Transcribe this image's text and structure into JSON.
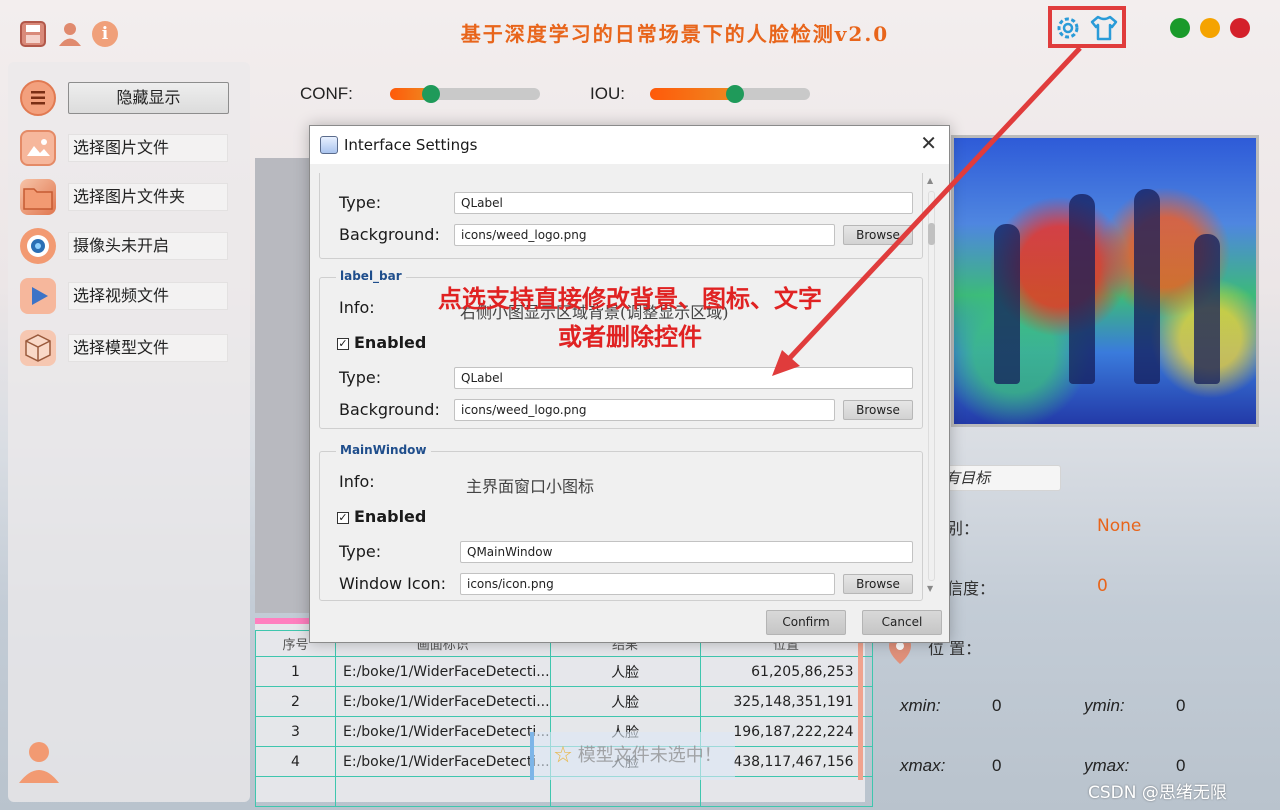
{
  "app": {
    "title": "基于深度学习的日常场景下的人脸检测v2.0"
  },
  "top_icons": [
    "save-icon",
    "user-icon",
    "info-icon"
  ],
  "header_tools": [
    "settings-gear-icon",
    "theme-shirt-icon"
  ],
  "window_controls": {
    "colors": [
      "#1a9a2a",
      "#f5a300",
      "#d4202a"
    ]
  },
  "sidebar": {
    "toggle_label": "隐藏显示",
    "items": [
      {
        "label": "选择图片文件",
        "icon": "image-file-icon"
      },
      {
        "label": "选择图片文件夹",
        "icon": "folder-icon"
      },
      {
        "label": "摄像头未开启",
        "icon": "camera-icon"
      },
      {
        "label": "选择视频文件",
        "icon": "video-play-icon"
      },
      {
        "label": "选择模型文件",
        "icon": "model-box-icon"
      }
    ]
  },
  "sliders": {
    "conf_label": "CONF:",
    "conf_value": 0.27,
    "iou_label": "IOU:",
    "iou_value": 0.53
  },
  "info_panel": {
    "target_placeholder": "有目标",
    "class_label": "别：",
    "class_value": "None",
    "conf_label": "信度：",
    "conf_value": "0",
    "pos_label": "位 置：",
    "xmin_label": "xmin:",
    "xmin_value": "0",
    "ymin_label": "ymin:",
    "ymin_value": "0",
    "xmax_label": "xmax:",
    "xmax_value": "0",
    "ymax_label": "ymax:",
    "ymax_value": "0"
  },
  "table": {
    "headers": [
      "序号",
      "画面标识",
      "结果",
      "位置"
    ],
    "rows": [
      [
        "1",
        "E:/boke/1/WiderFaceDetecti...",
        "人脸",
        "61,205,86,253"
      ],
      [
        "2",
        "E:/boke/1/WiderFaceDetecti...",
        "人脸",
        "325,148,351,191"
      ],
      [
        "3",
        "E:/boke/1/WiderFaceDetecti...",
        "人脸",
        "196,187,222,224"
      ],
      [
        "4",
        "E:/boke/1/WiderFaceDetecti...",
        "人脸",
        "438,117,467,156"
      ]
    ]
  },
  "toast": {
    "text": "模型文件未选中！"
  },
  "dialog": {
    "title": "Interface Settings",
    "close": "✕",
    "group0": {
      "type_label": "Type:",
      "type_value": "QLabel",
      "bg_label": "Background:",
      "bg_value": "icons/weed_logo.png",
      "browse": "Browse"
    },
    "group1": {
      "title": "label_bar",
      "info_label": "Info:",
      "info_value": "右侧小图显示区域背景(调整显示区域)",
      "enabled_label": "Enabled",
      "type_label": "Type:",
      "type_value": "QLabel",
      "bg_label": "Background:",
      "bg_value": "icons/weed_logo.png",
      "browse": "Browse"
    },
    "group2": {
      "title": "MainWindow",
      "info_label": "Info:",
      "info_value": "主界面窗口小图标",
      "enabled_label": "Enabled",
      "type_label": "Type:",
      "type_value": "QMainWindow",
      "icon_label": "Window Icon:",
      "icon_value": "icons/icon.png",
      "browse": "Browse"
    },
    "confirm": "Confirm",
    "cancel": "Cancel"
  },
  "annotation": {
    "line1": "点选支持直接修改背景、图标、文字",
    "line2": "或者删除控件"
  },
  "watermark": "CSDN @思绪无限"
}
